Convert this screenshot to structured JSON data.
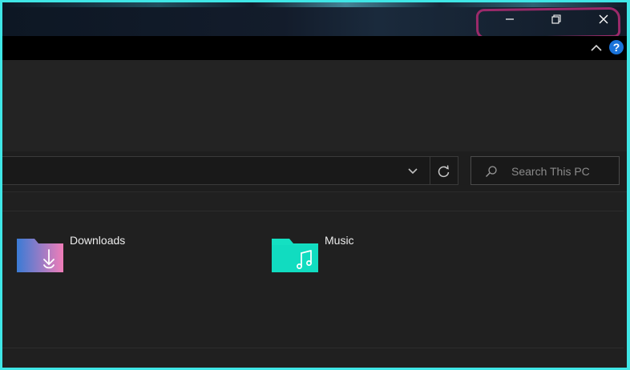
{
  "titlebar": {
    "minimize_icon": "minimize-icon",
    "maximize_icon": "restore-icon",
    "close_icon": "close-icon"
  },
  "ribbon": {
    "collapse_icon": "chevron-up-icon",
    "help_icon": "help-icon",
    "help_glyph": "?"
  },
  "address": {
    "dropdown_icon": "chevron-down-icon",
    "refresh_icon": "refresh-icon"
  },
  "search": {
    "placeholder": "Search This PC",
    "icon": "search-icon"
  },
  "folders": [
    {
      "label": "Downloads",
      "icon": "downloads-folder-icon"
    },
    {
      "label": "Music",
      "icon": "music-folder-icon"
    }
  ],
  "colors": {
    "window_border": "#3fe6e6",
    "annotation": "#9b2a6a",
    "help_blue": "#1a73d9",
    "downloads_gradient_start": "#3a7bd5",
    "downloads_gradient_end": "#f07db8",
    "music_color": "#14e0c2"
  }
}
